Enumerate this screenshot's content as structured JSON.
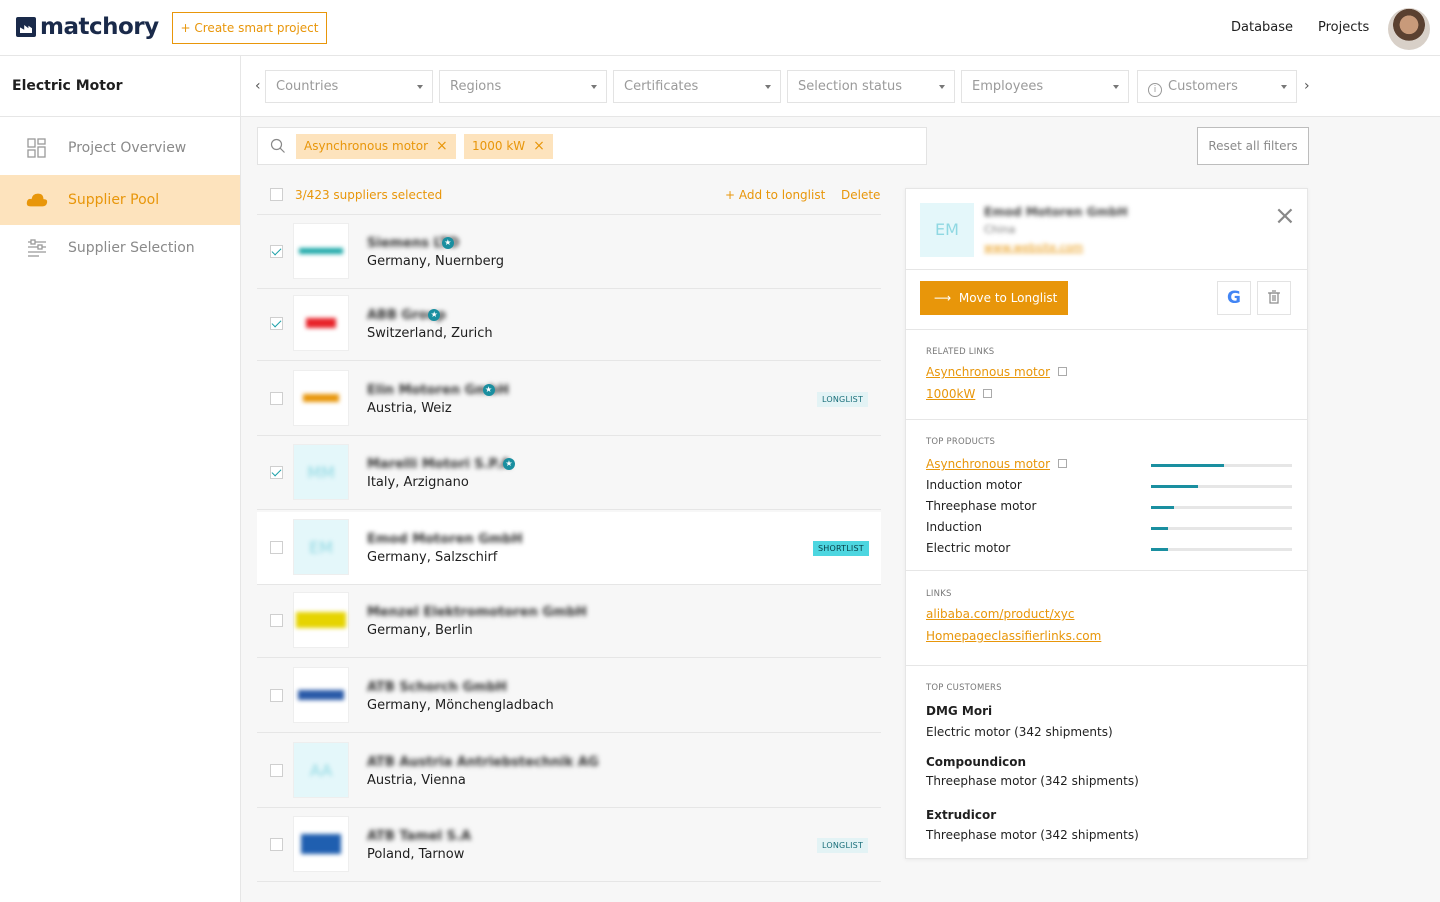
{
  "header": {
    "logo_text": "matchory",
    "create_button": "+ Create smart project",
    "nav": [
      "Database",
      "Projects"
    ]
  },
  "sidebar": {
    "project_title": "Electric Motor",
    "items": [
      {
        "label": "Project Overview",
        "icon": "grid-icon",
        "active": false
      },
      {
        "label": "Supplier Pool",
        "icon": "cloud-icon",
        "active": true
      },
      {
        "label": "Supplier Selection",
        "icon": "list-filter-icon",
        "active": false
      }
    ]
  },
  "filters": [
    "Countries",
    "Regions",
    "Certificates",
    "Selection status",
    "Employees",
    "Customers"
  ],
  "search": {
    "chips": [
      "Asynchronous motor",
      "1000 kW"
    ],
    "reset_label": "Reset all filters"
  },
  "list": {
    "selected_text": "3/423 suppliers selected",
    "add_longlist": "+ Add to longlist",
    "delete": "Delete",
    "rows": [
      {
        "name": "Siemens LTD",
        "location": "Germany, Nuernberg",
        "checked": true,
        "verified": true,
        "badge": "",
        "logo": "SIEMENS"
      },
      {
        "name": "ABB Group",
        "location": "Switzerland, Zurich",
        "checked": true,
        "verified": true,
        "badge": "",
        "logo": "ABB"
      },
      {
        "name": "Elin Motoren GmbH",
        "location": "Austria, Weiz",
        "checked": false,
        "verified": true,
        "badge": "LONGLIST",
        "logo": "ELIN"
      },
      {
        "name": "Marelli Motori S.P.A",
        "location": "Italy, Arzignano",
        "checked": true,
        "verified": true,
        "badge": "",
        "logo": "MM"
      },
      {
        "name": "Emod Motoren GmbH",
        "location": "Germany, Salzschirf",
        "checked": false,
        "verified": false,
        "badge": "SHORTLIST",
        "logo": "EM"
      },
      {
        "name": "Menzel Elektromotoren GmbH",
        "location": "Germany, Berlin",
        "checked": false,
        "verified": false,
        "badge": "",
        "logo": "MENZEL"
      },
      {
        "name": "ATB Schorch GmbH",
        "location": "Germany, Mönchengladbach",
        "checked": false,
        "verified": false,
        "badge": "",
        "logo": "SCHORCH"
      },
      {
        "name": "ATB Austria Antriebstechnik AG",
        "location": "Austria, Vienna",
        "checked": false,
        "verified": false,
        "badge": "",
        "logo": "AA"
      },
      {
        "name": "ATB Tamel S.A",
        "location": "Poland, Tarnow",
        "checked": false,
        "verified": false,
        "badge": "LONGLIST",
        "logo": "Tamel"
      }
    ]
  },
  "detail": {
    "logo": "EM",
    "name": "Emod Motoren GmbH",
    "country": "China",
    "url": "www.website.com",
    "move_button": "Move to Longlist",
    "related_title": "RELATED LINKS",
    "related_links": [
      "Asynchronous motor",
      "1000kW"
    ],
    "top_products_title": "TOP PRODUCTS",
    "products": [
      {
        "label": "Asynchronous motor",
        "link": true,
        "value": 0.52
      },
      {
        "label": "Induction motor",
        "link": false,
        "value": 0.33
      },
      {
        "label": "Threephase motor",
        "link": false,
        "value": 0.16
      },
      {
        "label": "Induction",
        "link": false,
        "value": 0.12
      },
      {
        "label": "Electric motor",
        "link": false,
        "value": 0.12
      }
    ],
    "links_title": "LINKS",
    "links": [
      "alibaba.com/product/xyc",
      "Homepageclassifierlinks.com"
    ],
    "customers_title": "TOP CUSTOMERS",
    "customers": [
      {
        "name": "DMG Mori",
        "desc": "Electric motor (342 shipments)"
      },
      {
        "name": "Compoundicon",
        "desc": "Threephase motor (342 shipments)"
      },
      {
        "name": "Extrudicor",
        "desc": "Threephase motor (342 shipments)"
      }
    ]
  },
  "colors": {
    "accent": "#e8960a",
    "accent_light": "#fde3bd",
    "teal": "#1a8fa0"
  }
}
